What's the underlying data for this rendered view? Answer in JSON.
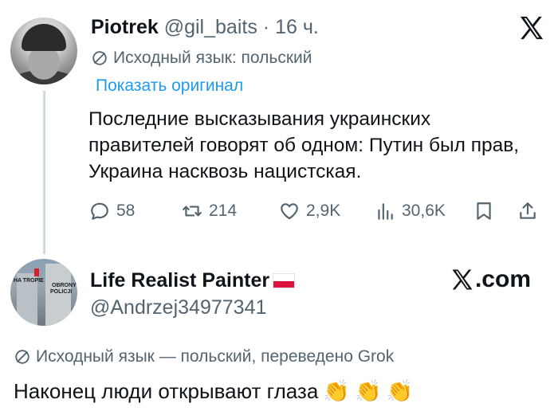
{
  "tweet1": {
    "display_name": "Piotrek",
    "handle": "@gil_baits",
    "separator": "·",
    "time": "16 ч.",
    "source_language": "Исходный язык: польский",
    "show_original": "Показать оригинал",
    "text": "Последние высказывания украинских правителей говорят об одном: Путин был прав, Украина насквозь нацистская.",
    "actions": {
      "replies": "58",
      "reposts": "214",
      "likes": "2,9K",
      "views": "30,6K"
    },
    "icons": [
      "x-logo-icon",
      "translate-icon",
      "reply-icon",
      "repost-icon",
      "like-icon",
      "views-icon",
      "bookmark-icon",
      "share-icon"
    ]
  },
  "tweet2": {
    "display_name": "Life Realist Painter",
    "handle": "@Andrzej34977341",
    "site_label": ".com",
    "source_language": "Исходный язык — польский, переведено Grok",
    "text": "Наконец люди открывают глаза",
    "emojis": [
      "👏",
      "👏",
      "👏"
    ],
    "avatar_text": [
      "HA TROPIE",
      "OBRONY",
      "POLICJI"
    ]
  },
  "colors": {
    "text": "#0f1419",
    "secondary": "#536471",
    "link": "#1d9bf0",
    "thread_line": "#cfd9de"
  }
}
